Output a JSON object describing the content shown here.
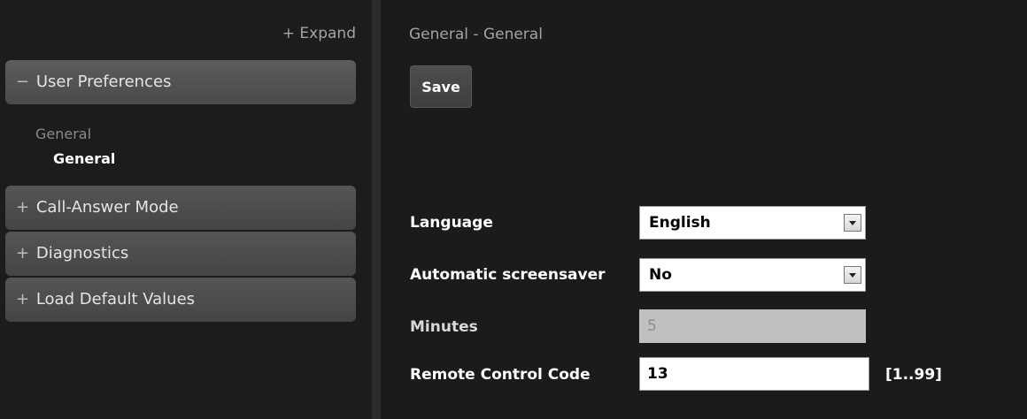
{
  "sidebar": {
    "expand_label": "+ Expand",
    "sections": [
      {
        "sign": "−",
        "label": "User Preferences"
      },
      {
        "sign": "+",
        "label": "Call-Answer Mode"
      },
      {
        "sign": "+",
        "label": "Diagnostics"
      },
      {
        "sign": "+",
        "label": "Load Default Values"
      }
    ],
    "subgroup_label": "General",
    "subitem_label": "General"
  },
  "main": {
    "breadcrumb": "General - General",
    "save_label": "Save",
    "fields": {
      "language": {
        "label": "Language",
        "value": "English"
      },
      "screensaver": {
        "label": "Automatic screensaver",
        "value": "No"
      },
      "minutes": {
        "label": "Minutes",
        "value": "5"
      },
      "remote_code": {
        "label": "Remote Control Code",
        "value": "13",
        "range": "[1..99]"
      }
    }
  },
  "colors": {
    "background": "#1b1b1b",
    "section_bg": "#4e4e4e",
    "text": "#ffffff",
    "muted_text": "#a3a3a3"
  },
  "icons": [
    "dropdown-arrow-icon"
  ]
}
